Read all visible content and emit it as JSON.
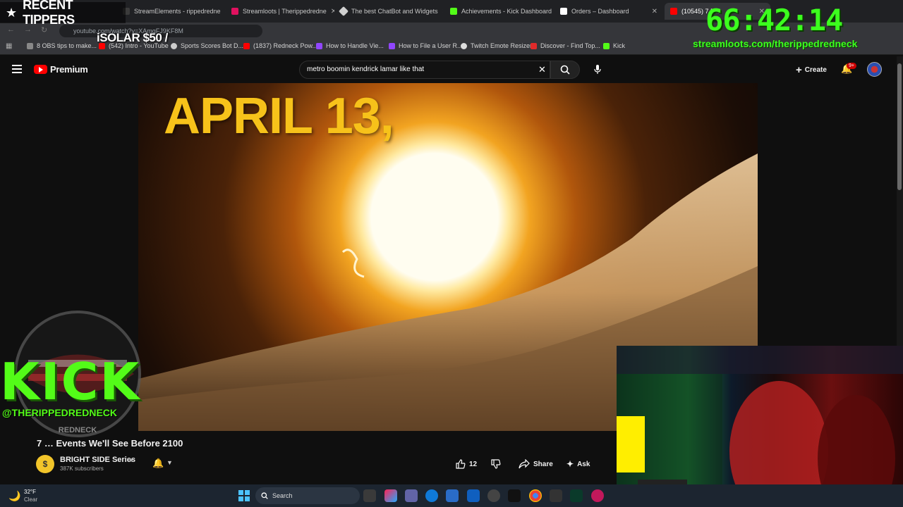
{
  "browser": {
    "tabs": [
      {
        "label": "StreamElements - rippedredne",
        "color": "#3b3b3b"
      },
      {
        "label": "Streamloots | Therippedredne",
        "color": "#e0115f"
      },
      {
        "label": "The best ChatBot and Widgets",
        "color": "#d0d0d0"
      },
      {
        "label": "Achievements - Kick Dashboard",
        "color": "#53fc18"
      },
      {
        "label": "Orders – Dashboard",
        "color": "#ffffff"
      },
      {
        "label": "(10545) 7 R…",
        "color": "#ff0000"
      }
    ],
    "url": "youtube.com/watch?v=XAmqFJ9KF8M",
    "bookmarks": [
      {
        "label": "8 OBS tips to make...",
        "color": "#888888"
      },
      {
        "label": "(542) Intro - YouTube",
        "color": "#ff0000"
      },
      {
        "label": "Sports Scores Bot D...",
        "color": "#cccccc"
      },
      {
        "label": "(1837) Redneck Pow...",
        "color": "#ff0000"
      },
      {
        "label": "How to Handle Vie...",
        "color": "#9146ff"
      },
      {
        "label": "How to File a User R...",
        "color": "#9146ff"
      },
      {
        "label": "Twitch Emote Resizer",
        "color": "#dddddd"
      },
      {
        "label": "Discover - Find Top...",
        "color": "#e02a2a"
      },
      {
        "label": "Kick",
        "color": "#53fc18"
      }
    ]
  },
  "youtube": {
    "brand": "Premium",
    "search_value": "metro boomin kendrick lamar like that",
    "create_label": "Create",
    "notif_badge": "9+"
  },
  "video": {
    "overlay_text": "APRIL 13,",
    "title": "7 … Events We'll See Before 2100",
    "channel": "BRIGHT SIDE Series",
    "channel_initial": "$",
    "subscribers": "387K subscribers",
    "likes": "12",
    "share_label": "Share",
    "ask_label": "Ask"
  },
  "overlays": {
    "tippers_title": "RECENT TIPPERS",
    "tipper_entry": "iSOLAR $50 /",
    "timer": "66:42:14",
    "stream_url": "streamloots.com/therippedredneck",
    "kick_text": "KICK",
    "kick_handle": "@THERIPPEDREDNECK",
    "kick_sub": "REDNECK"
  },
  "taskbar": {
    "temp": "32°F",
    "condition": "Clear",
    "search_label": "Search"
  },
  "icons": {
    "hamburger": "menu-icon",
    "search": "search-icon",
    "mic": "mic-icon",
    "bell": "bell-icon",
    "like": "thumbs-up-icon",
    "dislike": "thumbs-down-icon",
    "share": "share-icon",
    "ask": "sparkle-icon"
  }
}
